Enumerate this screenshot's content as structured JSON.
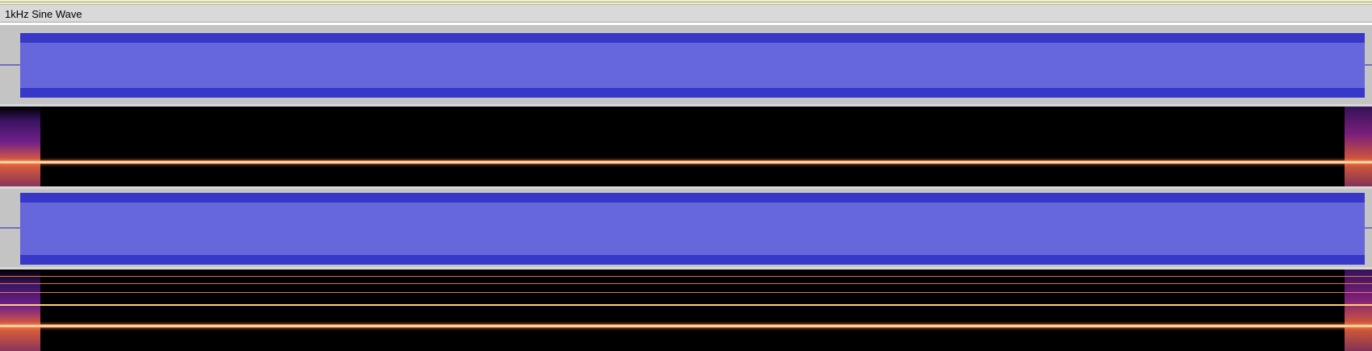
{
  "track": {
    "title": "1kHz Sine Wave"
  },
  "colors": {
    "waveform_body": "#6767dc",
    "waveform_edge": "#3737c8",
    "lane_background": "#c4c4c4",
    "spectrogram_background": "#000000",
    "tone_line": "#ff7a3a"
  },
  "channels": [
    {
      "view": "waveform"
    },
    {
      "view": "spectrogram"
    },
    {
      "view": "waveform"
    },
    {
      "view": "spectrogram"
    }
  ]
}
